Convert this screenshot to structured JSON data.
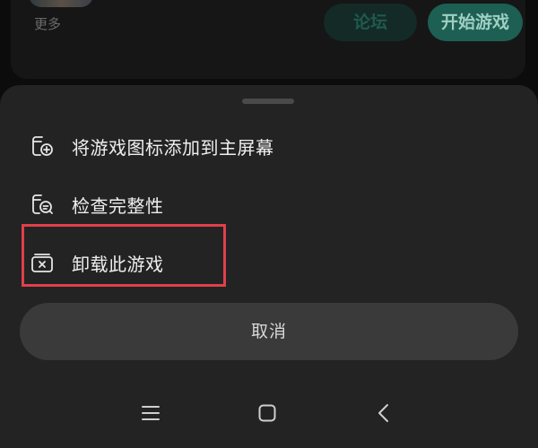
{
  "background": {
    "more_label": "更多",
    "forum_button": "论坛",
    "start_button": "开始游戏"
  },
  "sheet": {
    "items": [
      {
        "label": "将游戏图标添加到主屏幕",
        "icon": "add-to-home-icon"
      },
      {
        "label": "检查完整性",
        "icon": "check-integrity-icon"
      },
      {
        "label": "卸载此游戏",
        "icon": "uninstall-icon"
      }
    ],
    "cancel_label": "取消"
  },
  "nav": {
    "icons": [
      "menu-icon",
      "home-icon",
      "back-icon"
    ]
  },
  "colors": {
    "accent": "#1d5f53",
    "highlight": "#e0404a",
    "sheet_bg": "#232323"
  }
}
